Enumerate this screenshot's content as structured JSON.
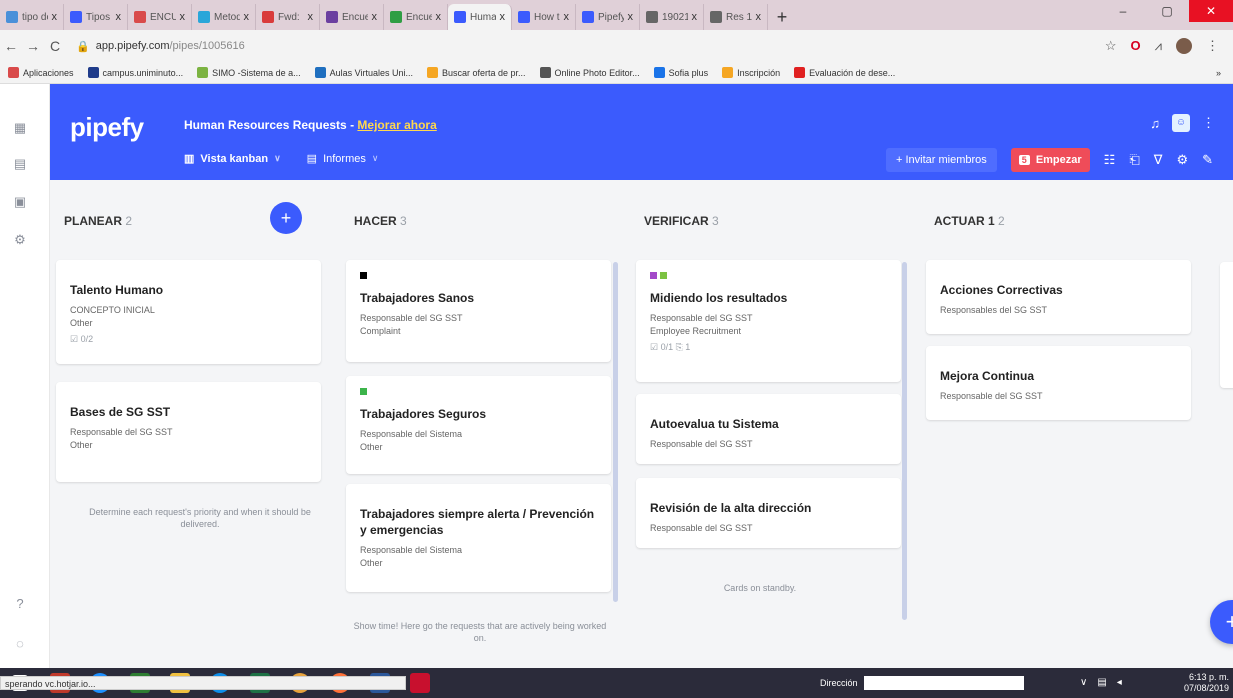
{
  "browser": {
    "tabs": [
      {
        "title": "tipo de",
        "color": "#4a90d9"
      },
      {
        "title": "Tipos",
        "color": "#3b5bfd"
      },
      {
        "title": "ENCU",
        "color": "#d94a4a"
      },
      {
        "title": "Metod",
        "color": "#2aa6d9"
      },
      {
        "title": "Fwd:",
        "color": "#d93b3b"
      },
      {
        "title": "Encue",
        "color": "#6b3fa0"
      },
      {
        "title": "Encue",
        "color": "#2f9e44"
      },
      {
        "title": "Huma",
        "color": "#3b5bfd"
      },
      {
        "title": "How t",
        "color": "#3b5bfd"
      },
      {
        "title": "Pipefy",
        "color": "#3b5bfd"
      },
      {
        "title": "19021",
        "color": "#666666"
      },
      {
        "title": "Res 1",
        "color": "#666666"
      }
    ],
    "tab_close": "x",
    "new_tab": "+",
    "window": {
      "minimize": "–",
      "maximize": "▢",
      "close": "✕"
    },
    "url_host": "app.pipefy.com",
    "url_path": "/pipes/1005616",
    "bookmarks": [
      {
        "label": "Aplicaciones",
        "color": "#d94a4a"
      },
      {
        "label": "campus.uniminuto...",
        "color": "#1f3b8a"
      },
      {
        "label": "SIMO -Sistema de a...",
        "color": "#7cb342"
      },
      {
        "label": "Aulas Virtuales Uni...",
        "color": "#1f6fbf"
      },
      {
        "label": "Buscar oferta de pr...",
        "color": "#f5a623"
      },
      {
        "label": "Online Photo Editor...",
        "color": "#555555"
      },
      {
        "label": "Sofia plus",
        "color": "#1a73e8"
      },
      {
        "label": "Inscripción",
        "color": "#f5a623"
      },
      {
        "label": "Evaluación de dese...",
        "color": "#e02020"
      }
    ],
    "bookmarks_more": "»"
  },
  "app": {
    "logo": "pipefy",
    "pipe_title": "Human Resources Requests",
    "separator": " - ",
    "upgrade_link": "Mejorar ahora",
    "views": [
      {
        "label": "Vista kanban",
        "icon": "kanban-icon"
      },
      {
        "label": "Informes",
        "icon": "reports-icon"
      }
    ],
    "invite_label": "+ Invitar miembros",
    "start_count": "5",
    "start_label": "Empezar",
    "accent": "#3b5bfd",
    "start_color": "#ef4c59"
  },
  "columns": [
    {
      "name": "PLANEAR",
      "count": "2",
      "cards": [
        {
          "title": "Talento Humano",
          "lines": [
            "CONCEPTO INICIAL",
            "Other"
          ],
          "meta": "☑ 0/2",
          "tags": []
        },
        {
          "title": "Bases de SG SST",
          "lines": [
            "Responsable del SG SST",
            "Other"
          ],
          "meta": "",
          "tags": []
        }
      ],
      "hint": "Determine each request's priority and when it should be delivered."
    },
    {
      "name": "HACER",
      "count": "3",
      "cards": [
        {
          "title": "Trabajadores Sanos",
          "lines": [
            "Responsable del SG SST",
            "Complaint"
          ],
          "meta": "",
          "tags": [
            "#000000"
          ]
        },
        {
          "title": "Trabajadores Seguros",
          "lines": [
            "Responsable del Sistema",
            "Other"
          ],
          "meta": "",
          "tags": [
            "#3cb44b"
          ]
        },
        {
          "title": "Trabajadores siempre alerta / Prevención y emergencias",
          "lines": [
            "Responsable del Sistema",
            "Other"
          ],
          "meta": "",
          "tags": []
        }
      ],
      "hint": "Show time! Here go the requests that are actively being worked on."
    },
    {
      "name": "VERIFICAR",
      "count": "3",
      "cards": [
        {
          "title": "Midiendo los resultados",
          "lines": [
            "Responsable del SG SST",
            "Employee Recruitment"
          ],
          "meta": "☑ 0/1  ⎘ 1",
          "tags": [
            "#a349c9",
            "#7cc242"
          ]
        },
        {
          "title": "Autoevalua tu Sistema",
          "lines": [
            "Responsable del SG SST"
          ],
          "meta": "",
          "tags": []
        },
        {
          "title": "Revisión de la alta dirección",
          "lines": [
            "Responsable del SG SST"
          ],
          "meta": "",
          "tags": []
        }
      ],
      "hint": "Cards on standby."
    },
    {
      "name": "ACTUAR 1",
      "count": "2",
      "cards": [
        {
          "title": "Acciones Correctivas",
          "lines": [
            "Responsables del SG SST"
          ],
          "meta": "",
          "tags": []
        },
        {
          "title": "Mejora Continua",
          "lines": [
            "Responsable del SG SST"
          ],
          "meta": "",
          "tags": []
        }
      ],
      "hint": ""
    }
  ],
  "add_card": "+",
  "status_text": "sperando vc.hotjar.io...",
  "taskbar": {
    "address_label": "Dirección",
    "time": "6:13 p. m.",
    "date": "07/08/2019"
  }
}
